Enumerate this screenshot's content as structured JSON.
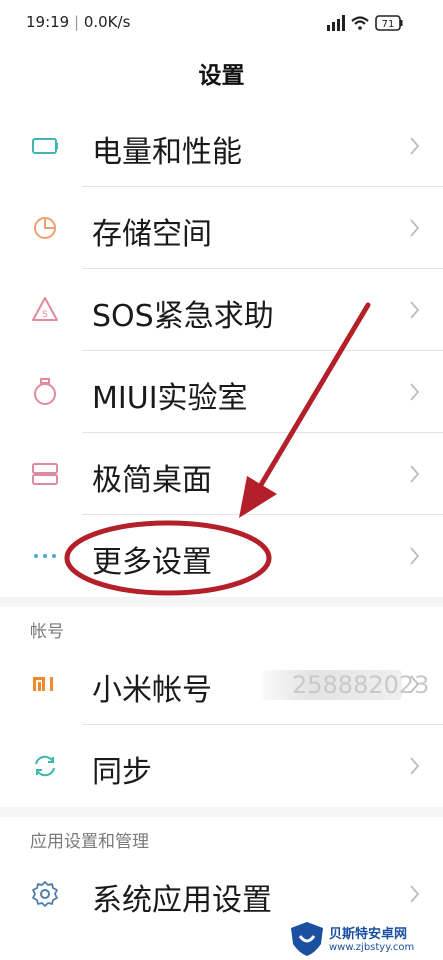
{
  "status_bar": {
    "time": "19:19",
    "speed": "0.0K/s",
    "battery": "71"
  },
  "page_title": "设置",
  "items": [
    {
      "label": "电量和性能"
    },
    {
      "label": "存储空间"
    },
    {
      "label": "SOS紧急求助"
    },
    {
      "label": "MIUI实验室"
    },
    {
      "label": "极简桌面"
    },
    {
      "label": "更多设置"
    }
  ],
  "account_section": {
    "header": "帐号",
    "items": [
      {
        "label": "小米帐号",
        "account_id": "258882023"
      },
      {
        "label": "同步"
      }
    ]
  },
  "apps_section": {
    "header": "应用设置和管理",
    "items": [
      {
        "label": "系统应用设置"
      }
    ]
  },
  "watermark": {
    "title": "贝斯特安卓网",
    "url": "www.zjbstyy.com"
  },
  "colors": {
    "icon_teal": "#3fb6b0",
    "icon_orange": "#f0a070",
    "icon_pink": "#e08a9a",
    "icon_blue": "#4fa7d4",
    "annotation_red": "#b3202a"
  }
}
